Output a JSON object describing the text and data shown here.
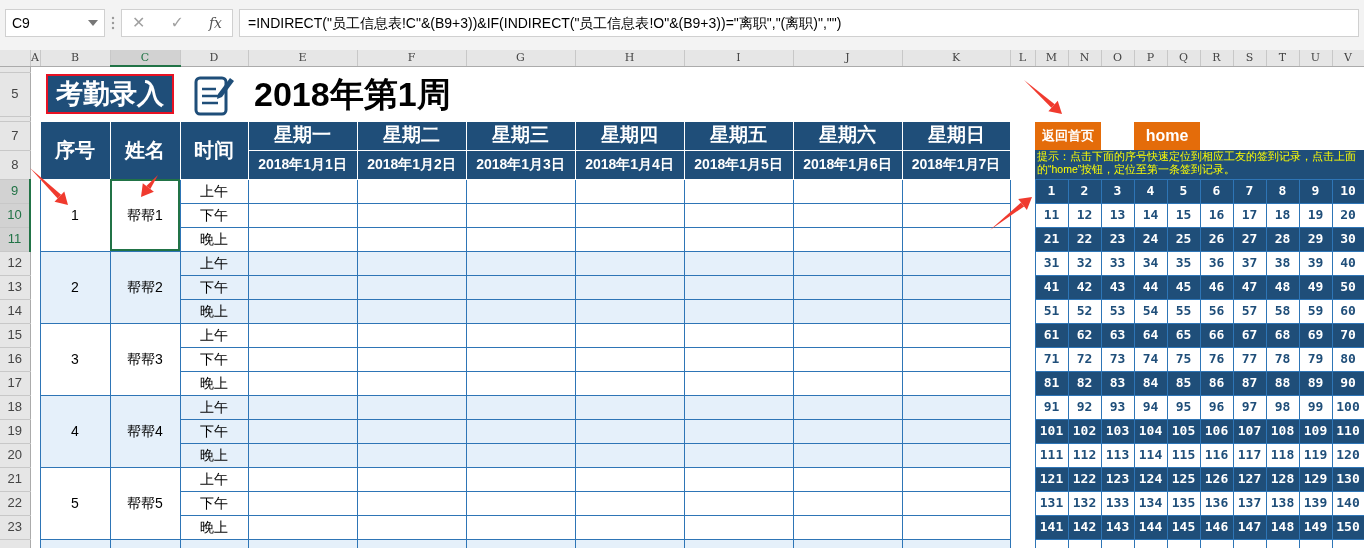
{
  "name_box": {
    "value": "C9"
  },
  "formula_buttons": [
    "✕",
    "✓",
    "fx"
  ],
  "formula": "=INDIRECT(\"员工信息表!C\"&(B9+3))&IF(INDIRECT(\"员工信息表!O\"&(B9+3))=\"离职\",\"(离职)\",\"\")",
  "columns": [
    {
      "label": "A",
      "selected": false
    },
    {
      "label": "B",
      "selected": false
    },
    {
      "label": "C",
      "selected": true
    },
    {
      "label": "D",
      "selected": false
    },
    {
      "label": "E",
      "selected": false
    },
    {
      "label": "F",
      "selected": false
    },
    {
      "label": "G",
      "selected": false
    },
    {
      "label": "H",
      "selected": false
    },
    {
      "label": "I",
      "selected": false
    },
    {
      "label": "J",
      "selected": false
    },
    {
      "label": "K",
      "selected": false
    },
    {
      "label": "L",
      "selected": false
    },
    {
      "label": "M",
      "selected": false
    },
    {
      "label": "N",
      "selected": false
    },
    {
      "label": "O",
      "selected": false
    },
    {
      "label": "P",
      "selected": false
    },
    {
      "label": "Q",
      "selected": false
    },
    {
      "label": "R",
      "selected": false
    },
    {
      "label": "S",
      "selected": false
    },
    {
      "label": "T",
      "selected": false
    },
    {
      "label": "U",
      "selected": false
    },
    {
      "label": "V",
      "selected": false
    }
  ],
  "row_headers": [
    {
      "label": "5",
      "selected": false
    },
    {
      "label": "7",
      "selected": false
    },
    {
      "label": "8",
      "selected": false
    },
    {
      "label": "9",
      "selected": true
    },
    {
      "label": "10",
      "selected": true
    },
    {
      "label": "11",
      "selected": true
    },
    {
      "label": "12",
      "selected": false
    },
    {
      "label": "13",
      "selected": false
    },
    {
      "label": "14",
      "selected": false
    },
    {
      "label": "15",
      "selected": false
    },
    {
      "label": "16",
      "selected": false
    },
    {
      "label": "17",
      "selected": false
    },
    {
      "label": "18",
      "selected": false
    },
    {
      "label": "19",
      "selected": false
    },
    {
      "label": "20",
      "selected": false
    },
    {
      "label": "21",
      "selected": false
    },
    {
      "label": "22",
      "selected": false
    },
    {
      "label": "23",
      "selected": false
    }
  ],
  "title": {
    "label": "考勤录入",
    "heading": "2018年第1周"
  },
  "table": {
    "headers": [
      "序号",
      "姓名",
      "时间"
    ],
    "days": [
      {
        "day": "星期一",
        "date": "2018年1月1日"
      },
      {
        "day": "星期二",
        "date": "2018年1月2日"
      },
      {
        "day": "星期三",
        "date": "2018年1月3日"
      },
      {
        "day": "星期四",
        "date": "2018年1月4日"
      },
      {
        "day": "星期五",
        "date": "2018年1月5日"
      },
      {
        "day": "星期六",
        "date": "2018年1月6日"
      },
      {
        "day": "星期日",
        "date": "2018年1月7日"
      }
    ],
    "people": [
      {
        "no": "1",
        "name": "帮帮1",
        "slots": [
          "上午",
          "下午",
          "晚上"
        ],
        "selected": true
      },
      {
        "no": "2",
        "name": "帮帮2",
        "slots": [
          "上午",
          "下午",
          "晚上"
        ],
        "selected": false
      },
      {
        "no": "3",
        "name": "帮帮3",
        "slots": [
          "上午",
          "下午",
          "晚上"
        ],
        "selected": false
      },
      {
        "no": "4",
        "name": "帮帮4",
        "slots": [
          "上午",
          "下午",
          "晚上"
        ],
        "selected": false
      },
      {
        "no": "5",
        "name": "帮帮5",
        "slots": [
          "上午",
          "下午",
          "晚上"
        ],
        "selected": false
      }
    ]
  },
  "panel": {
    "buttons": [
      "返回首页",
      "home"
    ],
    "hint": "提示：点击下面的序号快速定位到相应工友的签到记录，点击上面的“home”按钮，定位至第一条签到记录。",
    "numbers": [
      "1",
      "2",
      "3",
      "4",
      "5",
      "6",
      "7",
      "8",
      "9",
      "10",
      "11",
      "12",
      "13",
      "14",
      "15",
      "16",
      "17",
      "18",
      "19",
      "20",
      "21",
      "22",
      "23",
      "24",
      "25",
      "26",
      "27",
      "28",
      "29",
      "30",
      "31",
      "32",
      "33",
      "34",
      "35",
      "36",
      "37",
      "38",
      "39",
      "40",
      "41",
      "42",
      "43",
      "44",
      "45",
      "46",
      "47",
      "48",
      "49",
      "50",
      "51",
      "52",
      "53",
      "54",
      "55",
      "56",
      "57",
      "58",
      "59",
      "60",
      "61",
      "62",
      "63",
      "64",
      "65",
      "66",
      "67",
      "68",
      "69",
      "70",
      "71",
      "72",
      "73",
      "74",
      "75",
      "76",
      "77",
      "78",
      "79",
      "80",
      "81",
      "82",
      "83",
      "84",
      "85",
      "86",
      "87",
      "88",
      "89",
      "90",
      "91",
      "92",
      "93",
      "94",
      "95",
      "96",
      "97",
      "98",
      "99",
      "100",
      "101",
      "102",
      "103",
      "104",
      "105",
      "106",
      "107",
      "108",
      "109",
      "110",
      "111",
      "112",
      "113",
      "114",
      "115",
      "116",
      "117",
      "118",
      "119",
      "120",
      "121",
      "122",
      "123",
      "124",
      "125",
      "126",
      "127",
      "128",
      "129",
      "130",
      "131",
      "132",
      "133",
      "134",
      "135",
      "136",
      "137",
      "138",
      "139",
      "140",
      "141",
      "142",
      "143",
      "144",
      "145",
      "146",
      "147",
      "148",
      "149",
      "150"
    ]
  }
}
